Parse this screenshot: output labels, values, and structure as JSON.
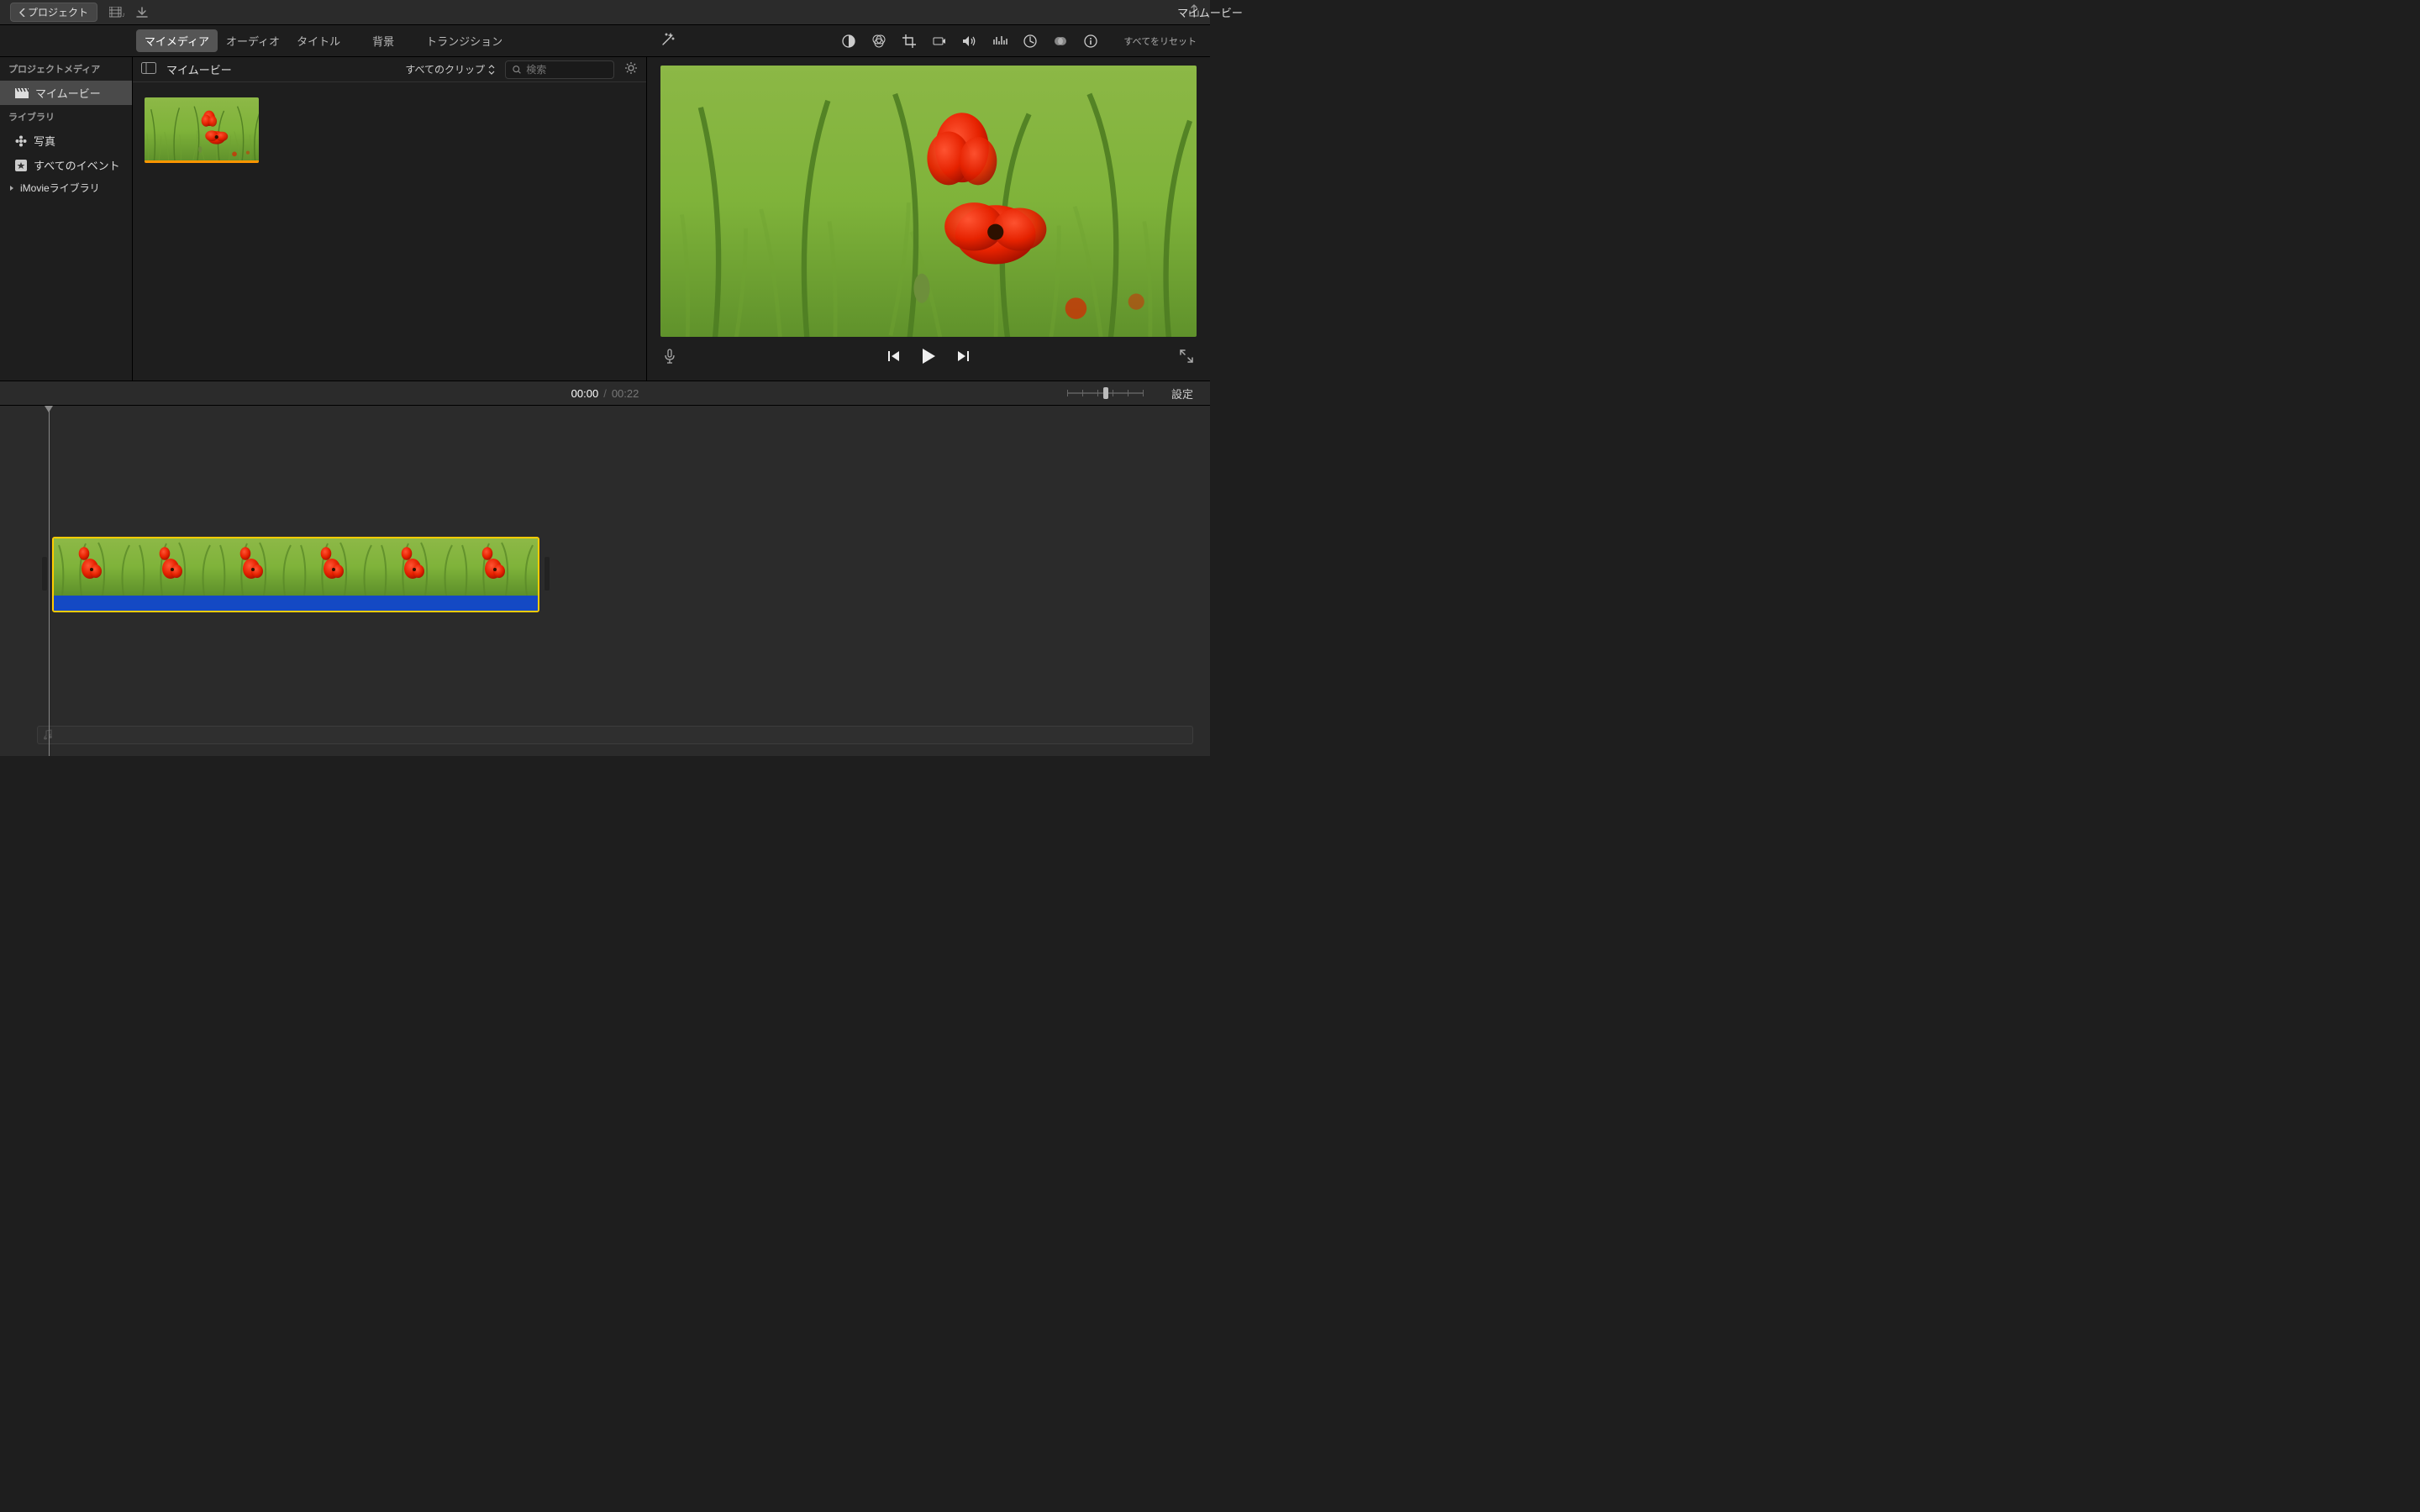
{
  "titlebar": {
    "back": "プロジェクト",
    "title": "マイムービー"
  },
  "tabs": {
    "media": "マイメディア",
    "audio": "オーディオ",
    "titles": "タイトル",
    "backgrounds": "背景",
    "transitions": "トランジション"
  },
  "viewer": {
    "reset_all": "すべてをリセット"
  },
  "sidebar": {
    "header": "プロジェクトメディア",
    "project": "マイムービー",
    "library_header": "ライブラリ",
    "photos": "写真",
    "all_events": "すべてのイベント",
    "imovie_library": "iMovieライブラリ"
  },
  "media": {
    "project_name": "マイムービー",
    "clips_filter": "すべてのクリップ",
    "search_placeholder": "検索"
  },
  "timeline": {
    "current": "00:00",
    "total": "00:22",
    "settings": "設定"
  }
}
